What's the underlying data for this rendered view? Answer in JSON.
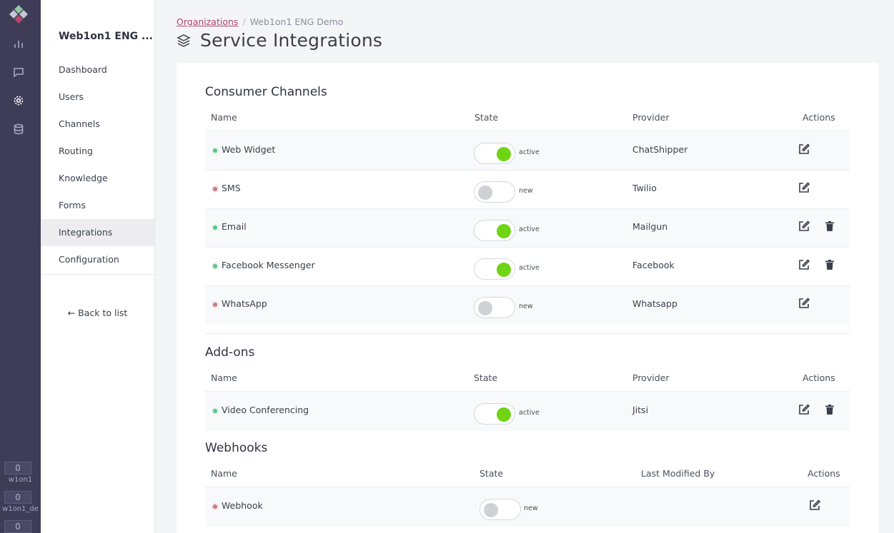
{
  "rail": {
    "counters": [
      {
        "value": "0",
        "label": "w1on1"
      },
      {
        "value": "0",
        "label": "w1on1_de"
      },
      {
        "value": "0",
        "label": ""
      }
    ]
  },
  "sidebar": {
    "org_name": "Web1on1 ENG ...",
    "items": [
      {
        "label": "Dashboard"
      },
      {
        "label": "Users"
      },
      {
        "label": "Channels"
      },
      {
        "label": "Routing"
      },
      {
        "label": "Knowledge"
      },
      {
        "label": "Forms"
      },
      {
        "label": "Integrations",
        "active": true
      },
      {
        "label": "Configuration"
      }
    ],
    "back_label": "Back to list"
  },
  "breadcrumb": {
    "root": "Organizations",
    "current": "Web1on1 ENG Demo"
  },
  "page": {
    "title": "Service Integrations"
  },
  "sections": {
    "consumer": {
      "title": "Consumer Channels",
      "headers": {
        "name": "Name",
        "state": "State",
        "provider": "Provider",
        "actions": "Actions"
      },
      "rows": [
        {
          "name": "Web Widget",
          "state": "active",
          "provider": "ChatShipper",
          "deletable": false
        },
        {
          "name": "SMS",
          "state": "new",
          "provider": "Twilio",
          "deletable": false
        },
        {
          "name": "Email",
          "state": "active",
          "provider": "Mailgun",
          "deletable": true
        },
        {
          "name": "Facebook Messenger",
          "state": "active",
          "provider": "Facebook",
          "deletable": true
        },
        {
          "name": "WhatsApp",
          "state": "new",
          "provider": "Whatsapp",
          "deletable": false
        }
      ]
    },
    "addons": {
      "title": "Add-ons",
      "headers": {
        "name": "Name",
        "state": "State",
        "provider": "Provider",
        "actions": "Actions"
      },
      "rows": [
        {
          "name": "Video Conferencing",
          "state": "active",
          "provider": "Jitsi",
          "deletable": true
        }
      ]
    },
    "webhooks": {
      "title": "Webhooks",
      "headers": {
        "name": "Name",
        "state": "State",
        "provider": "Last Modified By",
        "actions": "Actions"
      },
      "rows": [
        {
          "name": "Webhook",
          "state": "new",
          "provider": "",
          "deletable": false
        }
      ]
    }
  },
  "colors": {
    "accent_link": "#b0456d",
    "toggle_on": "#6fd414",
    "rail_bg": "#3e3c57"
  }
}
